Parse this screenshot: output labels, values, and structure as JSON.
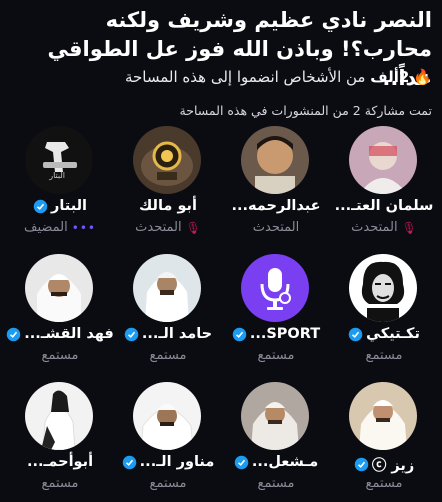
{
  "space": {
    "title": "النصر نادي عظيم وشريف ولكنه محارب؟! وباذن الله فوز عل الطواقي غداً..",
    "joined_count": "2ألف",
    "joined_text": "من الأشخاص انضموا إلى هذه المساحة",
    "shared_posts": "تمت مشاركة 2 من المنشورات في هذه المساحة"
  },
  "colors": {
    "background": "#0b0b12",
    "verified": "#1d9bf0",
    "muted": "#8b8b98",
    "mic_off": "#c2185b",
    "fire": "#ff4d5a"
  },
  "participants": [
    {
      "name": "البتار",
      "verified": true,
      "role": "المضيف",
      "role_icon": "dots-icon"
    },
    {
      "name": "أبو مالك",
      "verified": false,
      "role": "المتحدث",
      "role_icon": "mic-off-icon"
    },
    {
      "name": "عبدالرحمه...",
      "verified": false,
      "role": "المتحدث",
      "role_icon": ""
    },
    {
      "name": "سلمان العتـ...",
      "verified": false,
      "role": "المتحدث",
      "role_icon": "mic-off-icon"
    },
    {
      "name": "فهد القشـ...",
      "verified": true,
      "role": "مستمع",
      "role_icon": ""
    },
    {
      "name": "حامد الـ...",
      "verified": true,
      "role": "مستمع",
      "role_icon": ""
    },
    {
      "name": "SPORT...",
      "verified": true,
      "role": "مستمع",
      "role_icon": ""
    },
    {
      "name": "تكـتيكي",
      "verified": true,
      "role": "مستمع",
      "role_icon": ""
    },
    {
      "name": "أبوأحمـ...",
      "verified": false,
      "role": "مستمع",
      "role_icon": ""
    },
    {
      "name": "مناور الـ...",
      "verified": true,
      "role": "مستمع",
      "role_icon": ""
    },
    {
      "name": "مـشعل...",
      "verified": true,
      "role": "مستمع",
      "role_icon": ""
    },
    {
      "name": "زيز ⓒ",
      "verified": true,
      "role": "مستمع",
      "role_icon": ""
    }
  ]
}
